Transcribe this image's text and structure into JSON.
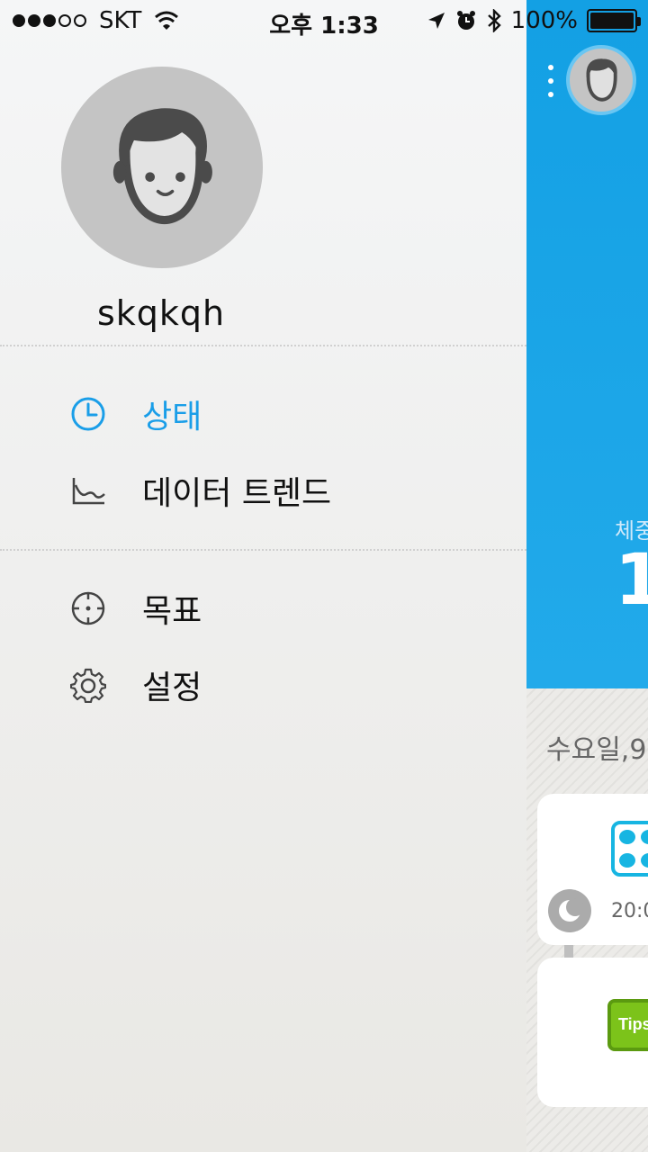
{
  "status_bar": {
    "carrier": "SKT",
    "time": "오후 1:33",
    "battery": "100%",
    "battery_level": 100
  },
  "drawer": {
    "username": "skqkqh",
    "menu": [
      {
        "label": "상태",
        "icon": "clock-icon",
        "active": true
      },
      {
        "label": "데이터 트렌드",
        "icon": "chart-line-icon",
        "active": false
      },
      {
        "label": "목표",
        "icon": "target-icon",
        "active": false
      },
      {
        "label": "설정",
        "icon": "gear-icon",
        "active": false
      }
    ]
  },
  "main": {
    "weight_label": "체중",
    "weight_value": "1",
    "date_label": "수요일,9",
    "sleep_time": "20:0",
    "tips_label": "Tips"
  },
  "colors": {
    "accent": "#1a9ee8",
    "header_blue": "#13a0e4",
    "tips_green": "#7cc31a",
    "device_cyan": "#17b5e2"
  }
}
